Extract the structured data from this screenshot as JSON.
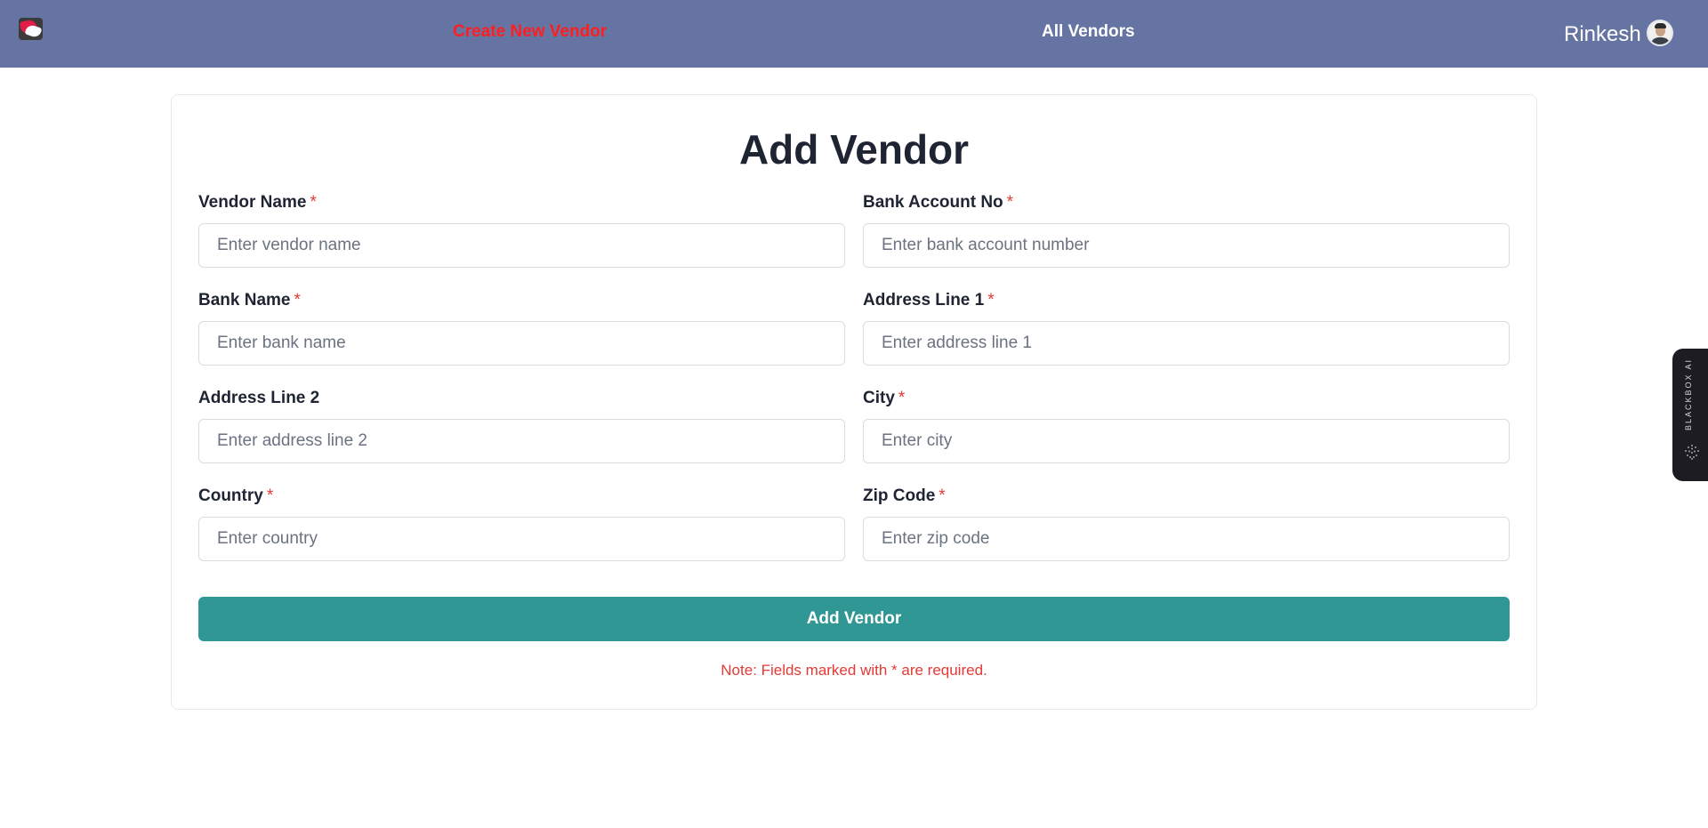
{
  "navbar": {
    "create_link": "Create New Vendor",
    "all_link": "All Vendors",
    "user_name": "Rinkesh"
  },
  "form": {
    "title": "Add Vendor",
    "required_marker": "*",
    "fields": [
      {
        "label": "Vendor Name",
        "placeholder": "Enter vendor name",
        "required": true
      },
      {
        "label": "Bank Account No",
        "placeholder": "Enter bank account number",
        "required": true
      },
      {
        "label": "Bank Name",
        "placeholder": "Enter bank name",
        "required": true
      },
      {
        "label": "Address Line 1",
        "placeholder": "Enter address line 1",
        "required": true
      },
      {
        "label": "Address Line 2",
        "placeholder": "Enter address line 2",
        "required": false
      },
      {
        "label": "City",
        "placeholder": "Enter city",
        "required": true
      },
      {
        "label": "Country",
        "placeholder": "Enter country",
        "required": true
      },
      {
        "label": "Zip Code",
        "placeholder": "Enter zip code",
        "required": true
      }
    ],
    "submit_label": "Add Vendor",
    "note": "Note: Fields marked with * are required."
  },
  "side_tab": {
    "label": "BLACKBOX AI"
  },
  "colors": {
    "navbar": "#6674a3",
    "active_link": "#ff1e1e",
    "submit": "#309795",
    "required": "#e53935"
  }
}
